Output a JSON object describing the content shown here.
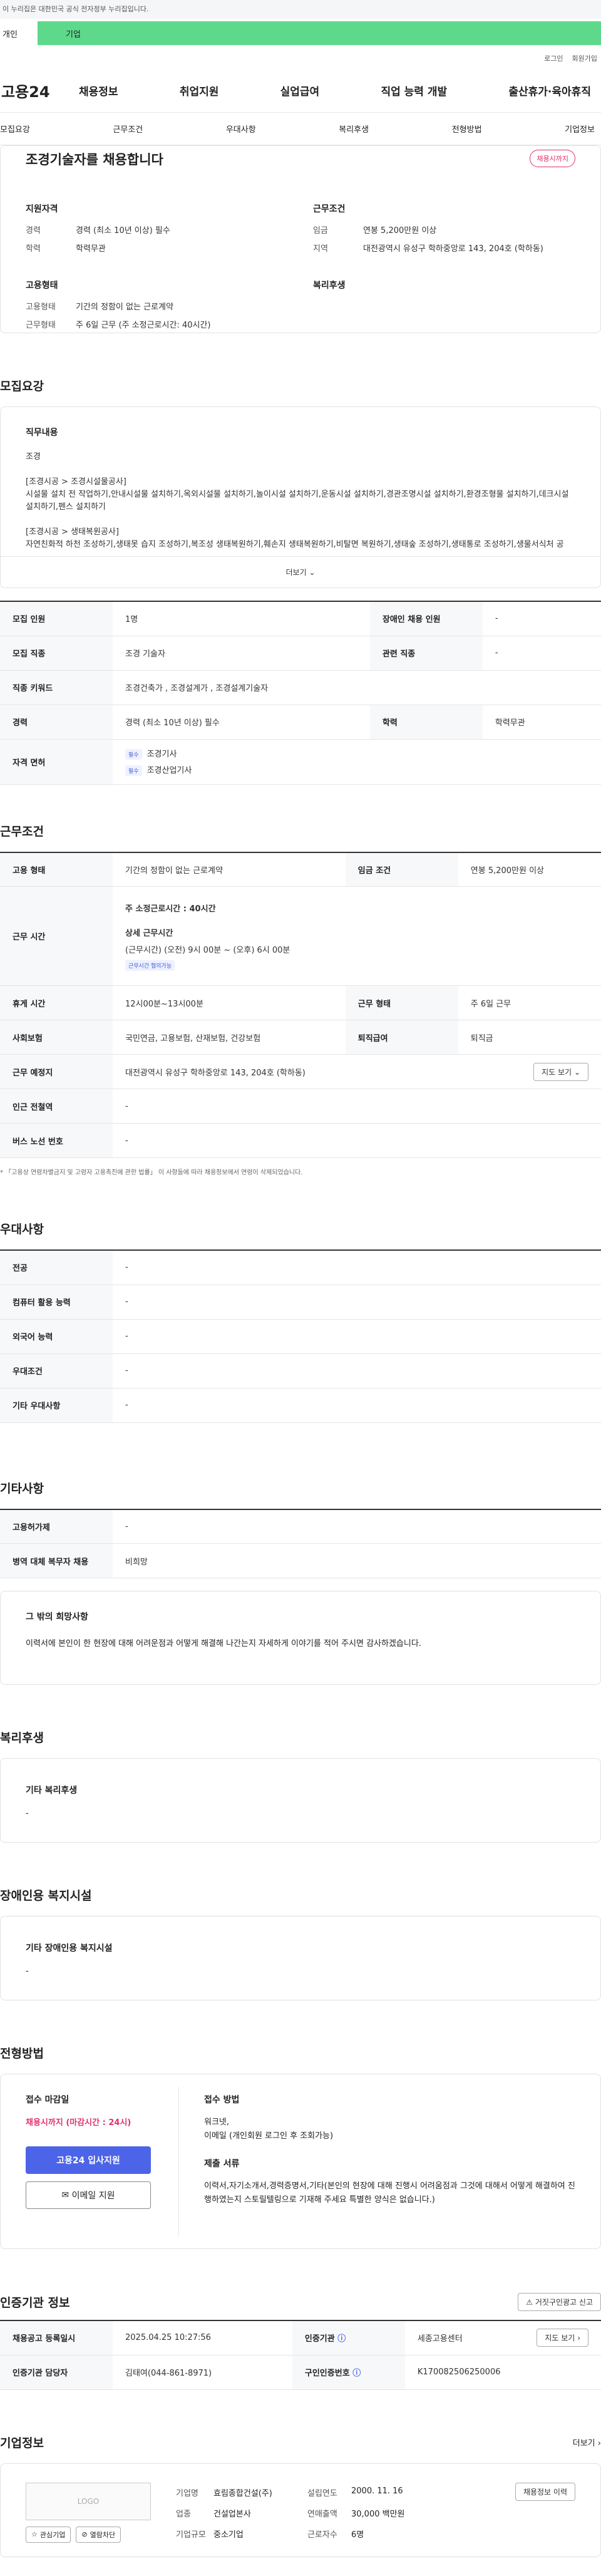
{
  "gov_bar": "이 누리집은 대한민국 공식 전자정부 누리집입니다.",
  "tabs": {
    "individual": "개인",
    "business": "기업"
  },
  "util": {
    "login": "로그인",
    "signup": "회원가입"
  },
  "logo": "고용24",
  "gnb": [
    "채용정보",
    "취업지원",
    "실업급여",
    "직업 능력 개발",
    "출산휴가·육아휴직"
  ],
  "subnav": [
    "모집요강",
    "근무조건",
    "우대사항",
    "복리후생",
    "전형방법",
    "기업정보"
  ],
  "title": "조경기술자를 채용합니다",
  "status_badge": "채용시까지",
  "summary": {
    "qual_title": "지원자격",
    "career_k": "경력",
    "career_v": "경력 (최소 10년 이상) 필수",
    "edu_k": "학력",
    "edu_v": "학력무관",
    "cond_title": "근무조건",
    "wage_k": "임금",
    "wage_v": "연봉 5,200만원 이상",
    "region_k": "지역",
    "region_v": "대전광역시 유성구 학하중앙로 143, 204호 (학하동)",
    "emp_title": "고용형태",
    "emptype_k": "고용형태",
    "emptype_v": "기간의 정함이 없는 근로계약",
    "worktype_k": "근무형태",
    "worktype_v": "주 6일 근무 (주 소정근로시간: 40시간)",
    "welfare_title": "복리후생"
  },
  "recruit": {
    "section_title": "모집요강",
    "job_title": "직무내용",
    "job_lines": [
      "조경",
      "",
      "[조경시공 > 조경시설물공사]",
      "시설물 설치 전 작업하기,안내시설물 설치하기,옥외시설물 설치하기,놀이시설 설치하기,운동시설 설치하기,경관조명시설 설치하기,환경조형물 설치하기,데크시설 설치하기,펜스 설치하기",
      "",
      "[조경시공 > 생태복원공사]",
      "자연친화적 하천 조성하기,생태못 습지 조성하기,복조성 생태복원하기,훼손지 생태복원하기,비탈면 복원하기,생태숲 조성하기,생태통로 조성하기,생물서식처 공"
    ],
    "more": "더보기",
    "rows": [
      {
        "k1": "모집 인원",
        "v1": "1명",
        "k2": "장애인 채용 인원",
        "v2": "-"
      },
      {
        "k1": "모집 직종",
        "v1": "조경 기술자",
        "k2": "관련 직종",
        "v2": "-"
      },
      {
        "k1": "직종 키워드",
        "v1": "조경건축가 , 조경설계가 , 조경설계기술자"
      },
      {
        "k1": "경력",
        "v1": "경력 (최소 10년 이상) 필수",
        "k2": "학력",
        "v2": "학력무관"
      }
    ],
    "license_k": "자격 면허",
    "license_tag": "필수",
    "licenses": [
      "조경기사",
      "조경산업기사"
    ]
  },
  "work": {
    "section_title": "근무조건",
    "emp_k": "고용 형태",
    "emp_v": "기간의 정함이 없는 근로계약",
    "wage_k": "임금 조건",
    "wage_v": "연봉 5,200만원 이상",
    "hours_k": "근무 시간",
    "hours_main_label": "주 소정근로시간",
    "hours_main_value": "40시간",
    "hours_detail_title": "상세 근무시간",
    "hours_detail": "(근무시간) (오전) 9시 00분 ~ (오후) 6시 00분",
    "hours_tag": "근무시간 협의가능",
    "break_k": "휴게 시간",
    "break_v": "12시00분~13시00분",
    "worktype_k": "근무 형태",
    "worktype_v": "주 6일 근무",
    "insurance_k": "사회보험",
    "insurance_v": "국민연금, 고용보험, 산재보험, 건강보험",
    "severance_k": "퇴직급여",
    "severance_v": "퇴직금",
    "place_k": "근무 예정지",
    "place_v": "대전광역시 유성구 학하중앙로 143, 204호 (학하동)",
    "map_btn": "지도 보기",
    "subway_k": "인근 전철역",
    "subway_v": "-",
    "bus_k": "버스 노선 번호",
    "bus_v": "-",
    "note": "* 「고용상 연령차별금지 및 고령자 고용촉진에 관한 법률」 이 사항들에 따라 채용정보에서 연령이 삭제되었습니다."
  },
  "pref": {
    "section_title": "우대사항",
    "rows": [
      {
        "k": "전공",
        "v": "-"
      },
      {
        "k": "컴퓨터 활용 능력",
        "v": "-"
      },
      {
        "k": "외국어 능력",
        "v": "-"
      },
      {
        "k": "우대조건",
        "v": "-"
      },
      {
        "k": "기타 우대사항",
        "v": "-"
      }
    ]
  },
  "etc": {
    "section_title": "기타사항",
    "rows": [
      {
        "k": "고용허가제",
        "v": "-"
      },
      {
        "k": "병역 대체 복무자 채용",
        "v": "비희망"
      }
    ],
    "wish_title": "그 밖의 희망사항",
    "wish_text": "이력서에 본인이 한 현장에 대해 어려운점과 어떻게 해결해 나간는지 자세하게 이야기를 적어 주시면 감사하겠습니다."
  },
  "welfare": {
    "section_title": "복리후생",
    "sub": "기타 복리후생",
    "value": "-"
  },
  "disabled": {
    "section_title": "장애인용 복지시설",
    "sub": "기타 장애인용 복지시설",
    "value": "-"
  },
  "selection": {
    "section_title": "전형방법",
    "deadline_title": "접수 마감일",
    "deadline_value": "채용시까지 (마감시간 : 24시)",
    "apply_btn": "고용24 입사지원",
    "email_btn": "이메일 지원",
    "method_title": "접수 방법",
    "method_lines": [
      "워크넷,",
      "이메일 (개인회원 로그인 후 조회가능)"
    ],
    "docs_title": "제출 서류",
    "docs_text": "이력서,자기소개서,경력증명서,기타(본인의 현장에 대해 진행시 어려움점과 그것에 대해서 어떻게 해결하여 진행하였는지 스토릴텔링으로 기재해 주세요 특별한 양식은 없습니다.)"
  },
  "cert": {
    "section_title": "인증기관 정보",
    "report_btn": "거짓구인광고 신고",
    "reg_k": "채용공고 등록일시",
    "reg_v": "2025.04.25 10:27:56",
    "agency_k": "인증기관",
    "agency_v": "세종고용센터",
    "map_btn": "지도 보기",
    "manager_k": "인증기관 담당자",
    "manager_v": "김태여(044-861-8971)",
    "number_k": "구인인증번호",
    "number_v": "K170082506250006"
  },
  "company": {
    "section_title": "기업정보",
    "more": "더보기",
    "logo_text": "LOGO",
    "fav_btn": "관심기업",
    "block_btn": "열람차단",
    "name_k": "기업명",
    "name_v": "효림종합건설(주)",
    "est_k": "설립연도",
    "est_v": "2000. 11. 16",
    "biz_k": "업종",
    "biz_v": "건설업본사",
    "sales_k": "연매출액",
    "sales_v": "30,000 백만원",
    "size_k": "기업규모",
    "size_v": "중소기업",
    "emp_k": "근로자수",
    "emp_v": "6명",
    "recruit_btn": "채용정보 이력"
  },
  "colors": {
    "accent": "#4c64e8",
    "green": "#5ed88a",
    "pink": "#e0326c"
  }
}
